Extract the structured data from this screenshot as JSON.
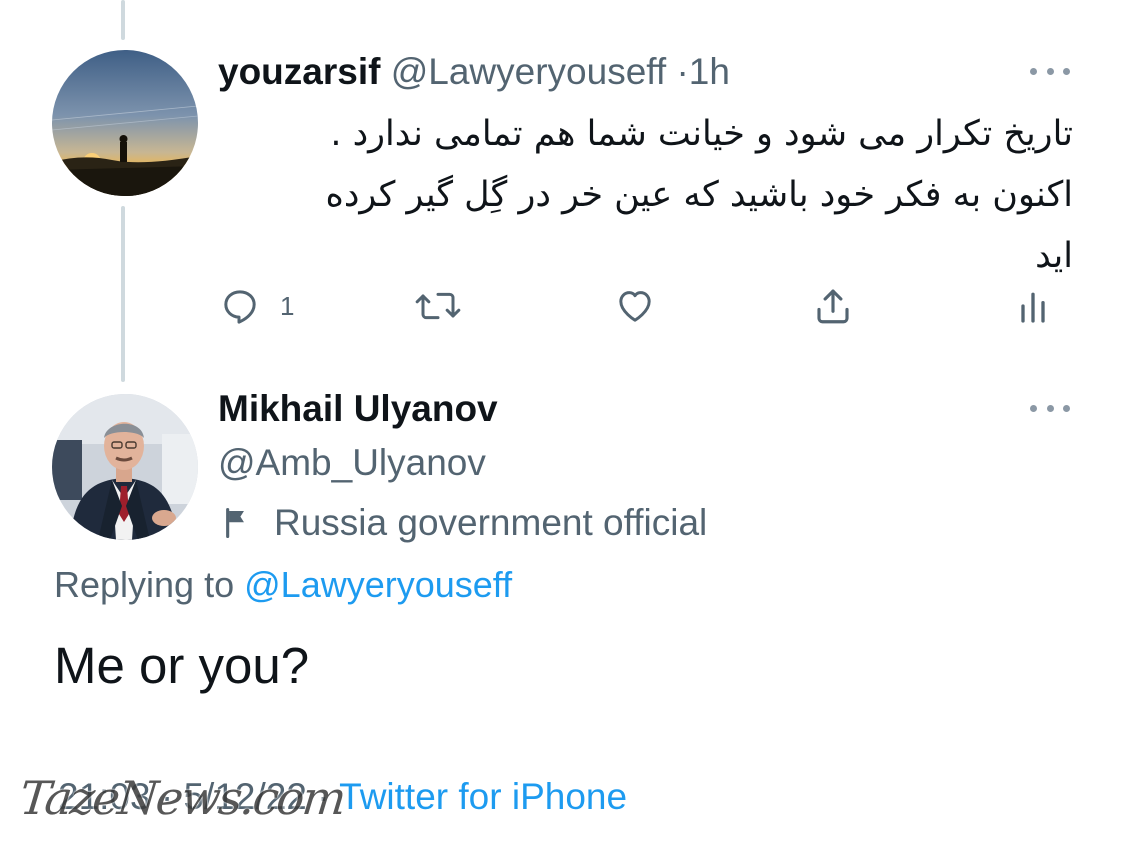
{
  "reply_parent": {
    "display_name": "youzarsif",
    "handle": "@Lawyeryouseff",
    "separator": "·",
    "time": "1h",
    "text_lines": [
      "تاریخ تکرار می شود و خیانت شما هم تمامی ندارد .",
      "اکنون به فکر خود باشید که عین خر در گِل گیر کرده",
      "اید"
    ],
    "actions": {
      "reply_count": "1",
      "reply_icon": "reply-icon",
      "retweet_icon": "retweet-icon",
      "like_icon": "heart-icon",
      "share_icon": "share-icon",
      "analytics_icon": "analytics-icon"
    }
  },
  "main_tweet": {
    "display_name": "Mikhail Ulyanov",
    "handle": "@Amb_Ulyanov",
    "account_label": "Russia government official",
    "replying_prefix": "Replying to",
    "replying_mention": "@Lawyeryouseff",
    "text": "Me or you?",
    "date": "21:03 · 5/12/22",
    "date_separator": "·",
    "source": "Twitter for iPhone"
  },
  "watermark": "TazeNews.com",
  "colors": {
    "text_primary": "#0f1419",
    "text_secondary": "#536471",
    "link_blue": "#1d9bf0",
    "thread_line": "#cfd9de"
  }
}
